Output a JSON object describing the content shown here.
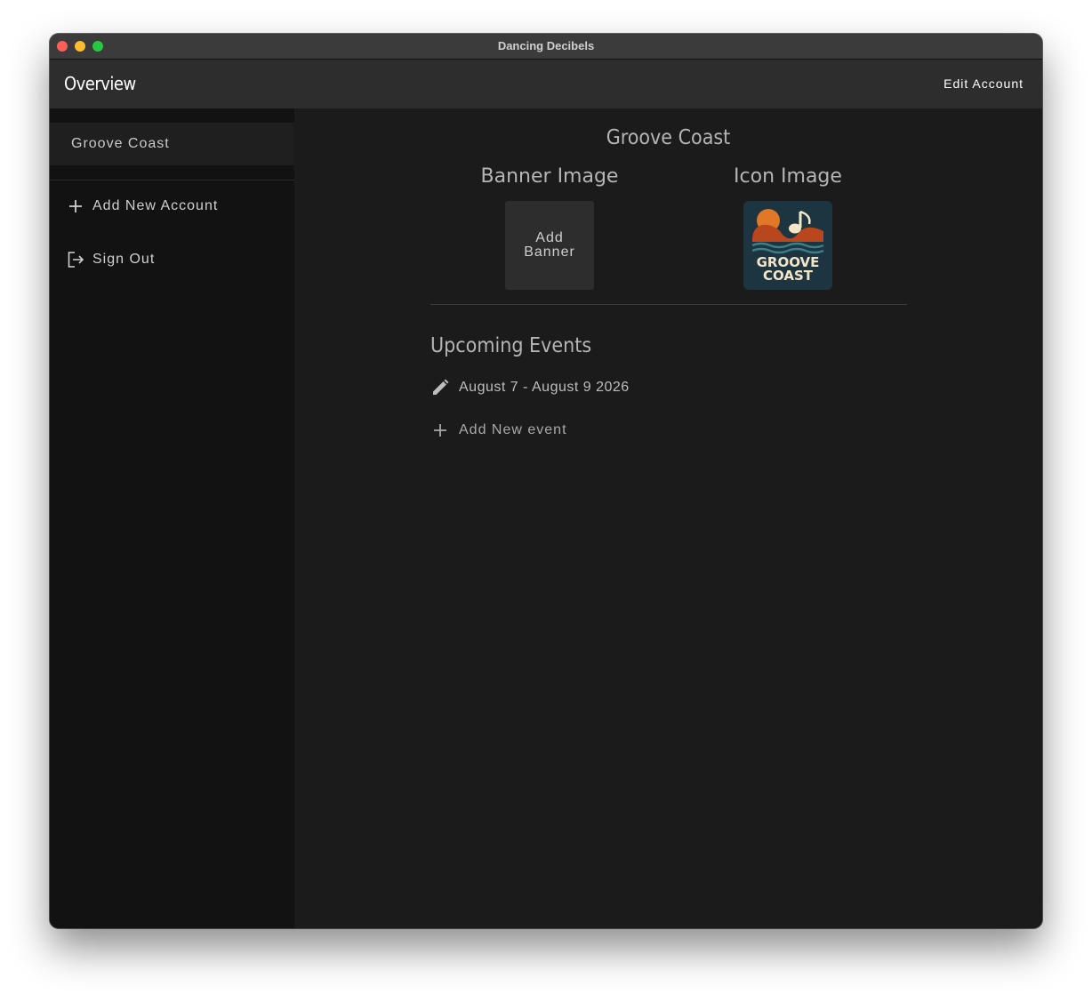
{
  "window": {
    "title": "Dancing Decibels"
  },
  "appbar": {
    "title": "Overview",
    "edit_account_label": "Edit Account"
  },
  "sidebar": {
    "accounts": [
      {
        "label": "Groove Coast"
      }
    ],
    "actions": [
      {
        "label": "Add New Account",
        "icon": "plus-icon"
      },
      {
        "label": "Sign Out",
        "icon": "logout-icon"
      }
    ]
  },
  "main": {
    "account_name": "Groove Coast",
    "banner": {
      "title": "Banner Image",
      "button_line1": "Add",
      "button_line2": "Banner"
    },
    "icon": {
      "title": "Icon Image",
      "logo_line1": "GROOVE",
      "logo_line2": "COAST"
    },
    "events": {
      "title": "Upcoming Events",
      "items": [
        {
          "label": "August 7 - August 9 2026",
          "icon": "pencil-icon"
        }
      ],
      "add_label": "Add New event"
    }
  },
  "colors": {
    "window_bg": "#1b1b1b",
    "sidebar_bg": "#121212",
    "appbar_bg": "#2d2d2d",
    "logo_bg": "#1d3540",
    "logo_orange": "#e07826",
    "logo_rust": "#b8471e",
    "logo_cream": "#f3e5c8",
    "logo_teal": "#3f7d8a"
  }
}
